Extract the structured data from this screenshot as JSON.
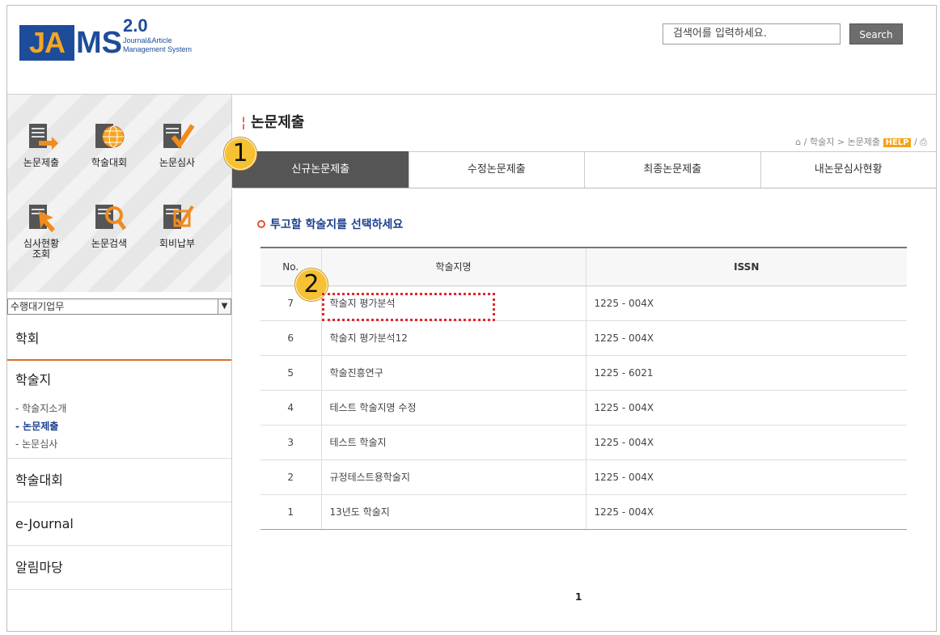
{
  "header": {
    "logo": {
      "ja": "JA",
      "ms": "MS",
      "version": "2.0",
      "subtitle_line1": "Journal&Article",
      "subtitle_line2": "Management System"
    },
    "search": {
      "value": "검색어를 입력하세요.",
      "button": "Search"
    }
  },
  "sidebar": {
    "quick_menu": [
      {
        "label": "논문제출",
        "icon": "doc-arrow-icon"
      },
      {
        "label": "학술대회",
        "icon": "globe-icon"
      },
      {
        "label": "논문심사",
        "icon": "doc-check-icon"
      },
      {
        "label": "심사현황",
        "label2": "조회",
        "icon": "doc-cursor-icon"
      },
      {
        "label": "논문검색",
        "icon": "doc-search-icon"
      },
      {
        "label": "회비납부",
        "icon": "doc-pen-icon"
      }
    ],
    "select": {
      "value": "수행대기업무"
    },
    "nav": {
      "society": "학회",
      "journal": "학술지",
      "journal_subs": [
        "- 학술지소개",
        "- 논문제출",
        "- 논문심사"
      ],
      "conference": "학술대회",
      "ejournal": "e-Journal",
      "notice": "알림마당"
    }
  },
  "content": {
    "title": "논문제출",
    "breadcrumb": {
      "path": "학술지 > 논문제출",
      "help": "HELP",
      "sep": "/"
    },
    "tabs": [
      "신규논문제출",
      "수정논문제출",
      "최종논문제출",
      "내논문심사현황"
    ],
    "select_title": "투고할 학술지를 선택하세요",
    "table": {
      "headers": [
        "No.",
        "학술지명",
        "ISSN"
      ],
      "rows": [
        {
          "no": "7",
          "name": "학술지 평가분석",
          "issn": "1225 - 004X"
        },
        {
          "no": "6",
          "name": "학술지 평가분석12",
          "issn": "1225 - 004X"
        },
        {
          "no": "5",
          "name": "학술진흥연구",
          "issn": "1225 - 6021"
        },
        {
          "no": "4",
          "name": "테스트 학술지명 수정",
          "issn": "1225 - 004X"
        },
        {
          "no": "3",
          "name": "테스트 학술지",
          "issn": "1225 - 004X"
        },
        {
          "no": "2",
          "name": "규정테스트용학술지",
          "issn": "1225 - 004X"
        },
        {
          "no": "1",
          "name": "13년도 학술지",
          "issn": "1225 - 004X"
        }
      ]
    },
    "pager": "1"
  },
  "annotations": {
    "step1": "1",
    "step2": "2"
  }
}
